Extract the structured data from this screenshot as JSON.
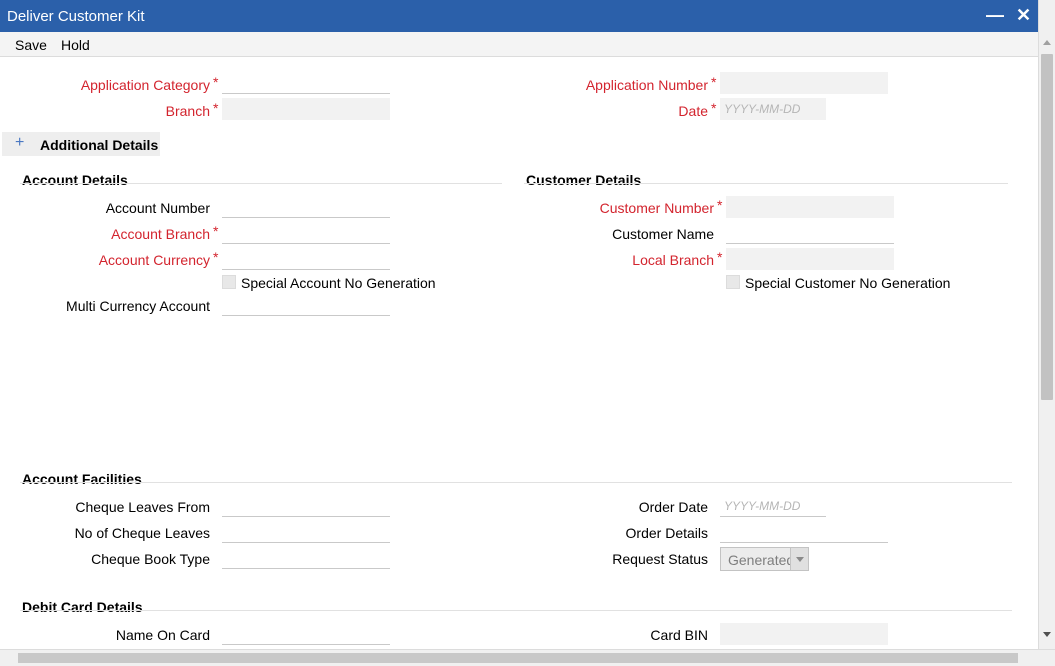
{
  "window": {
    "title": "Deliver Customer Kit",
    "minimize_glyph": "—",
    "close_glyph": "✕"
  },
  "toolbar": {
    "save_label": "Save",
    "hold_label": "Hold"
  },
  "header": {
    "application_category": {
      "label": "Application Category",
      "value": ""
    },
    "branch": {
      "label": "Branch",
      "value": ""
    },
    "application_number": {
      "label": "Application Number",
      "value": ""
    },
    "date": {
      "label": "Date",
      "placeholder": "YYYY-MM-DD"
    }
  },
  "additional_details": {
    "label": "Additional Details",
    "icon": "plus-icon"
  },
  "account_details": {
    "heading": "Account Details",
    "account_number": {
      "label": "Account Number",
      "value": ""
    },
    "account_branch": {
      "label": "Account Branch",
      "value": ""
    },
    "account_currency": {
      "label": "Account Currency",
      "value": ""
    },
    "special_account_no_generation": {
      "label": "Special Account No Generation",
      "checked": false
    },
    "multi_currency_account": {
      "label": "Multi Currency Account",
      "value": ""
    }
  },
  "customer_details": {
    "heading": "Customer Details",
    "customer_number": {
      "label": "Customer Number",
      "value": ""
    },
    "customer_name": {
      "label": "Customer Name",
      "value": ""
    },
    "local_branch": {
      "label": "Local Branch",
      "value": ""
    },
    "special_customer_no_generation": {
      "label": "Special Customer No Generation",
      "checked": false
    }
  },
  "account_facilities": {
    "heading": "Account Facilities",
    "cheque_leaves_from": {
      "label": "Cheque Leaves From",
      "value": ""
    },
    "no_of_cheque_leaves": {
      "label": "No of Cheque Leaves",
      "value": ""
    },
    "cheque_book_type": {
      "label": "Cheque Book Type",
      "value": ""
    },
    "order_date": {
      "label": "Order Date",
      "placeholder": "YYYY-MM-DD"
    },
    "order_details": {
      "label": "Order Details",
      "value": ""
    },
    "request_status": {
      "label": "Request Status",
      "selected": "Generated"
    }
  },
  "debit_card_details": {
    "heading": "Debit Card Details",
    "name_on_card": {
      "label": "Name On Card",
      "value": ""
    },
    "card_bin": {
      "label": "Card BIN",
      "value": ""
    }
  },
  "required_marker": "*",
  "colors": {
    "titlebar": "#2b60aa",
    "required_label": "#d3242e",
    "accent_icon": "#4a78c2"
  }
}
